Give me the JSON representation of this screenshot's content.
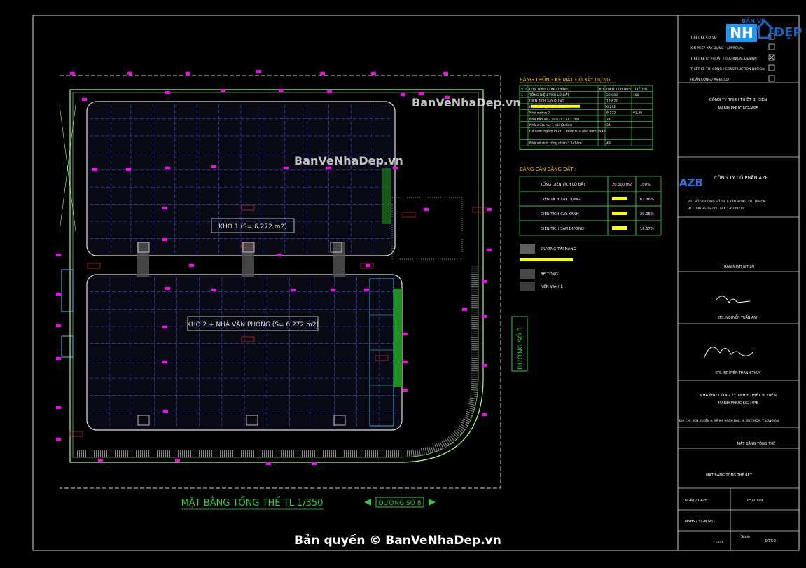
{
  "sheet": {
    "plan_title": "MẶT BẰNG TỔNG THỂ TL 1/350",
    "road_east": "ĐƯỜNG SỐ 3",
    "road_south": "ĐƯỜNG SỐ 8",
    "copyright": "Bản quyền © BanVeNhaDep.vn"
  },
  "watermarks": [
    "BanVeNhaDep.vn",
    "BanVeNhaDep.vn"
  ],
  "logo": {
    "top": "BẢN VẼ",
    "mid": "NH",
    "right": "ĐẸP"
  },
  "buildings": {
    "kho1_label": "KHO 1 (S= 6.272 m2)",
    "kho2_label": "KHO 2 + NHÀ VĂN PHÒNG (S= 6.272 m2)"
  },
  "stats_table": {
    "title": "BẢNG THỐNG KÊ MẬT ĐỘ XÂY DỰNG",
    "headers": [
      "STT",
      "LOẠI HÌNH CÔNG TRÌNH",
      "KH",
      "DIỆN TÍCH (m²)",
      "TỈ LỆ (%)"
    ],
    "rows": [
      [
        "1",
        "TỔNG DIỆN TÍCH LÔ ĐẤT",
        "",
        "20.000",
        "100"
      ],
      [
        "",
        "DIỆN TÍCH XÂY DỰNG",
        "",
        "12.677",
        ""
      ],
      [
        "",
        "Nhà xưởng 1 (56x112m)",
        "",
        "6.272",
        ""
      ],
      [
        "",
        "Nhà xưởng 2",
        "",
        "6.272",
        "63.36"
      ],
      [
        "",
        "Nhà bảo vệ 2 cái (2x3.4x3.5m)",
        "",
        "24",
        ""
      ],
      [
        "",
        "Nhà chứa rác 1 cái (3x8m)",
        "",
        "24",
        ""
      ],
      [
        "",
        "Hồ nước ngầm PCCC (350m3) + nhà bơm 3x4m",
        "",
        "",
        ""
      ],
      [
        "",
        "Nhà vệ sinh công nhân 3.5x14m",
        "",
        "49",
        ""
      ]
    ]
  },
  "balance_table": {
    "title": "BẢNG CÂN BẰNG ĐẤT :",
    "rows": [
      [
        "TỔNG DIỆN TÍCH LÔ ĐẤT",
        "20.000 m2",
        "100%"
      ],
      [
        "DIỆN TÍCH XÂY DỰNG",
        "",
        "63.36%"
      ],
      [
        "DIỆN TÍCH CÂY XANH",
        "",
        "20.05%"
      ],
      [
        "DIỆN TÍCH SÂN ĐƯỜNG",
        "",
        "16.57%"
      ]
    ]
  },
  "legend": {
    "items": [
      "ĐƯỜNG TẢI NẶNG",
      "",
      "BÊ TÔNG",
      "NỀN VIA HÈ"
    ]
  },
  "title_block": {
    "stages": [
      "THIẾT KẾ CƠ SỞ",
      "XIN PHÉP XÂY DỰNG / APPROVAL",
      "THIẾT KẾ KỸ THUẬT / TECHNICAL DESIGN",
      "THIẾT KẾ THI CÔNG / CONSTRUCTION DESIGN",
      "HOÀN CÔNG / AS-BUILD"
    ],
    "designer_company": [
      "CÔNG TY TNHH THIẾT BỊ ĐIỆN",
      "MẠNH PHƯƠNG-MPE"
    ],
    "contractor_name": "CÔNG TY CỔ PHẦN AZB",
    "contractor_logo": "AZB",
    "contractor_address": "VP : SỐ 5 ĐƯỜNG SỐ 13, P. TÂN HƯNG, Q7, TP.HCM",
    "contractor_phone": "ĐT : (08) 36209210 , FAX : 36209211",
    "person1": "TRẦN MINH NHƠN",
    "person2": "KTS. NGUYỄN TUẤN ANH",
    "person3": "KTS. NGUYỄN THANH THỦY",
    "project_name": [
      "NHÀ MÁY CÔNG TY TNHH THIẾT BỊ ĐIỆN",
      "MẠNH PHƯƠNG-MPE"
    ],
    "project_address": "ĐỊA CHỈ: KCN XUYÊN Á, XÃ MỸ HẠNH BẮC, H. ĐỨC HÒA, T. LONG AN",
    "drawing_name": "MẶT BẰNG TỔNG THỂ",
    "drawing_detail": "MẶT BẰNG TỔNG THỂ RÉT",
    "date_label": "NGÀY / DATE :",
    "date_value": "05/2019",
    "sign_label": "MSHS / SIGN No :",
    "drawing_no": "TT-01",
    "scale_label": "Scale",
    "scale_value": "1/350"
  }
}
